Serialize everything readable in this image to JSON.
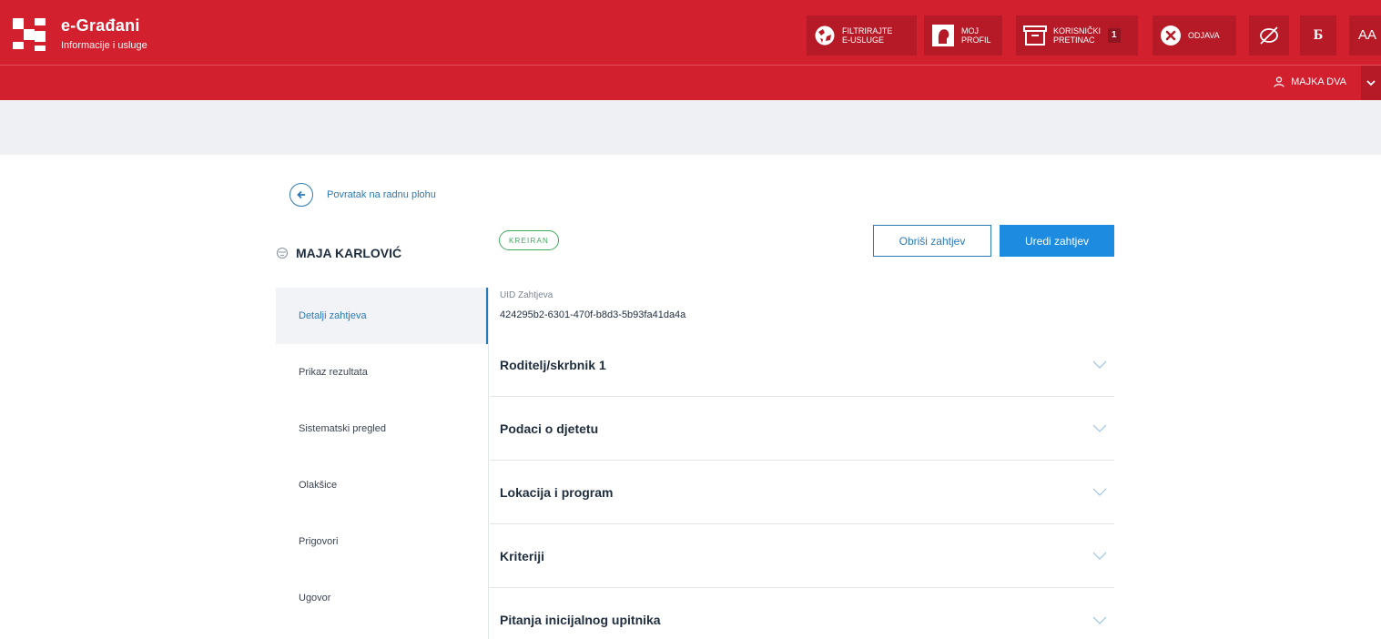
{
  "header": {
    "brand_title": "e-Građani",
    "brand_subtitle": "Informacije i usluge",
    "filter_label": "FILTRIRAJTE\nE-USLUGE",
    "profile_label": "MOJ\nPROFIL",
    "inbox_label": "KORISNIČKI\nPRETINAC",
    "inbox_count": "1",
    "logout_label": "ODJAVA",
    "font_toggle_label": "AA",
    "script_toggle_label": "Б"
  },
  "userbar": {
    "user_name": "MAJKA DVA"
  },
  "nav": {
    "back_label": "Povratak na radnu plohu"
  },
  "person": {
    "name": "MAJA KARLOVIĆ"
  },
  "sidebar": {
    "items": [
      {
        "label": "Detalji zahtjeva"
      },
      {
        "label": "Prikaz rezultata"
      },
      {
        "label": "Sistematski pregled"
      },
      {
        "label": "Olakšice"
      },
      {
        "label": "Prigovori"
      },
      {
        "label": "Ugovor"
      }
    ]
  },
  "main": {
    "status": "KREIRAN",
    "delete_label": "Obriši zahtjev",
    "edit_label": "Uredi zahtjev",
    "uid_label": "UID Zahtjeva",
    "uid_value": "424295b2-6301-470f-b8d3-5b93fa41da4a",
    "sections": [
      {
        "title": "Roditelj/skrbnik 1"
      },
      {
        "title": "Podaci o djetetu"
      },
      {
        "title": "Lokacija i program"
      },
      {
        "title": "Kriteriji"
      },
      {
        "title": "Pitanja inicijalnog upitnika"
      }
    ]
  },
  "colors": {
    "brand_red": "#d3202f",
    "accent_blue": "#1c8be0",
    "status_green": "#3eaa5c"
  }
}
